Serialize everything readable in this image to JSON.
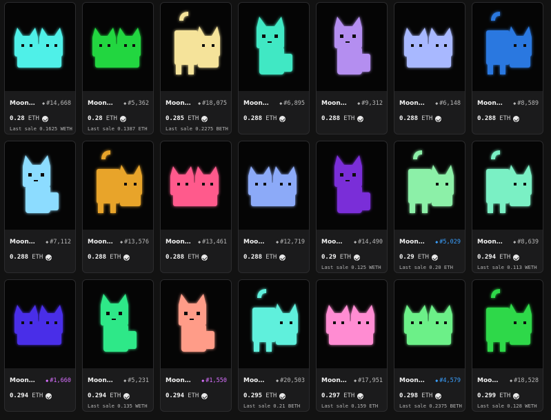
{
  "cards": [
    {
      "name": "Moon…",
      "token": "#14,668",
      "price": "0.28",
      "currency": "ETH",
      "last_sale": "Last sale 0.1625 WETH",
      "cat_color": "#4ff0e8",
      "pose": "lying",
      "accent": "#ffffff"
    },
    {
      "name": "Moon…",
      "token": "#5,362",
      "price": "0.28",
      "currency": "ETH",
      "last_sale": "Last sale 0.1387 ETH",
      "cat_color": "#22d640",
      "pose": "lying",
      "accent": "#ffffff"
    },
    {
      "name": "Moon…",
      "token": "#18,075",
      "price": "0.285",
      "currency": "ETH",
      "last_sale": "Last sale 0.2275 BETH",
      "cat_color": "#f5e39a",
      "pose": "standing",
      "accent": "#ffffff"
    },
    {
      "name": "Moon…",
      "token": "#6,895",
      "price": "0.288",
      "currency": "ETH",
      "last_sale": "",
      "cat_color": "#3fe8c4",
      "pose": "sitting",
      "accent": "#ffffff"
    },
    {
      "name": "Moon…",
      "token": "#9,312",
      "price": "0.288",
      "currency": "ETH",
      "last_sale": "",
      "cat_color": "#b48ef0",
      "pose": "sitting",
      "accent": "#ffffff"
    },
    {
      "name": "Moon…",
      "token": "#6,148",
      "price": "0.288",
      "currency": "ETH",
      "last_sale": "",
      "cat_color": "#a8b8ff",
      "pose": "lying",
      "accent": "#ffffff"
    },
    {
      "name": "Moon…",
      "token": "#8,589",
      "price": "0.288",
      "currency": "ETH",
      "last_sale": "",
      "cat_color": "#2a78e0",
      "pose": "standing",
      "accent": "#ffffff"
    },
    {
      "name": "Moon…",
      "token": "#7,112",
      "price": "0.288",
      "currency": "ETH",
      "last_sale": "",
      "cat_color": "#8cdcff",
      "pose": "sitting",
      "accent": "#ffffff"
    },
    {
      "name": "Moon…",
      "token": "#13,576",
      "price": "0.288",
      "currency": "ETH",
      "last_sale": "",
      "cat_color": "#e8a42a",
      "pose": "standing",
      "accent": "#ffffff"
    },
    {
      "name": "Moon…",
      "token": "#13,461",
      "price": "0.288",
      "currency": "ETH",
      "last_sale": "",
      "cat_color": "#ff5a8c",
      "pose": "lying",
      "accent": "#ffffff"
    },
    {
      "name": "Moo…",
      "token": "#12,719",
      "price": "0.288",
      "currency": "ETH",
      "last_sale": "",
      "cat_color": "#8caaf8",
      "pose": "lying",
      "accent": "#ffffff"
    },
    {
      "name": "Moo…",
      "token": "#14,490",
      "price": "0.29",
      "currency": "ETH",
      "last_sale": "Last sale 0.125 WETH",
      "cat_color": "#7a2ed8",
      "pose": "sitting",
      "accent": "#ffffff"
    },
    {
      "name": "Moon…",
      "token": "#5,029",
      "price": "0.29",
      "currency": "ETH",
      "last_sale": "Last sale 0.20 ETH",
      "cat_color": "#8cf0a8",
      "pose": "standing",
      "accent": "#3aa0ff"
    },
    {
      "name": "Moon…",
      "token": "#8,639",
      "price": "0.294",
      "currency": "ETH",
      "last_sale": "Last sale 0.113 WETH",
      "cat_color": "#7af0c4",
      "pose": "standing",
      "accent": "#ffffff"
    },
    {
      "name": "Moon…",
      "token": "#1,660",
      "price": "0.294",
      "currency": "ETH",
      "last_sale": "",
      "cat_color": "#4a2ee8",
      "pose": "lying",
      "accent": "#d870ff"
    },
    {
      "name": "Moon…",
      "token": "#5,231",
      "price": "0.294",
      "currency": "ETH",
      "last_sale": "Last sale 0.135 WETH",
      "cat_color": "#2ee888",
      "pose": "sitting",
      "accent": "#ffffff"
    },
    {
      "name": "Moon…",
      "token": "#1,550",
      "price": "0.294",
      "currency": "ETH",
      "last_sale": "",
      "cat_color": "#ff9c88",
      "pose": "sitting",
      "accent": "#d870ff"
    },
    {
      "name": "Moo…",
      "token": "#20,503",
      "price": "0.295",
      "currency": "ETH",
      "last_sale": "Last sale 0.21 BETH",
      "cat_color": "#5ff0dc",
      "pose": "standing",
      "accent": "#ffffff"
    },
    {
      "name": "Moon…",
      "token": "#17,951",
      "price": "0.297",
      "currency": "ETH",
      "last_sale": "Last sale 0.159 ETH",
      "cat_color": "#ff8cd2",
      "pose": "lying",
      "accent": "#ffffff"
    },
    {
      "name": "Moon…",
      "token": "#4,579",
      "price": "0.298",
      "currency": "ETH",
      "last_sale": "Last sale 0.2375 BETH",
      "cat_color": "#6cf088",
      "pose": "lying",
      "accent": "#3aa0ff"
    },
    {
      "name": "Moo…",
      "token": "#18,528",
      "price": "0.299",
      "currency": "ETH",
      "last_sale": "Last sale 0.128 WETH",
      "cat_color": "#2ed84a",
      "pose": "standing",
      "accent": "#ffffff"
    }
  ]
}
